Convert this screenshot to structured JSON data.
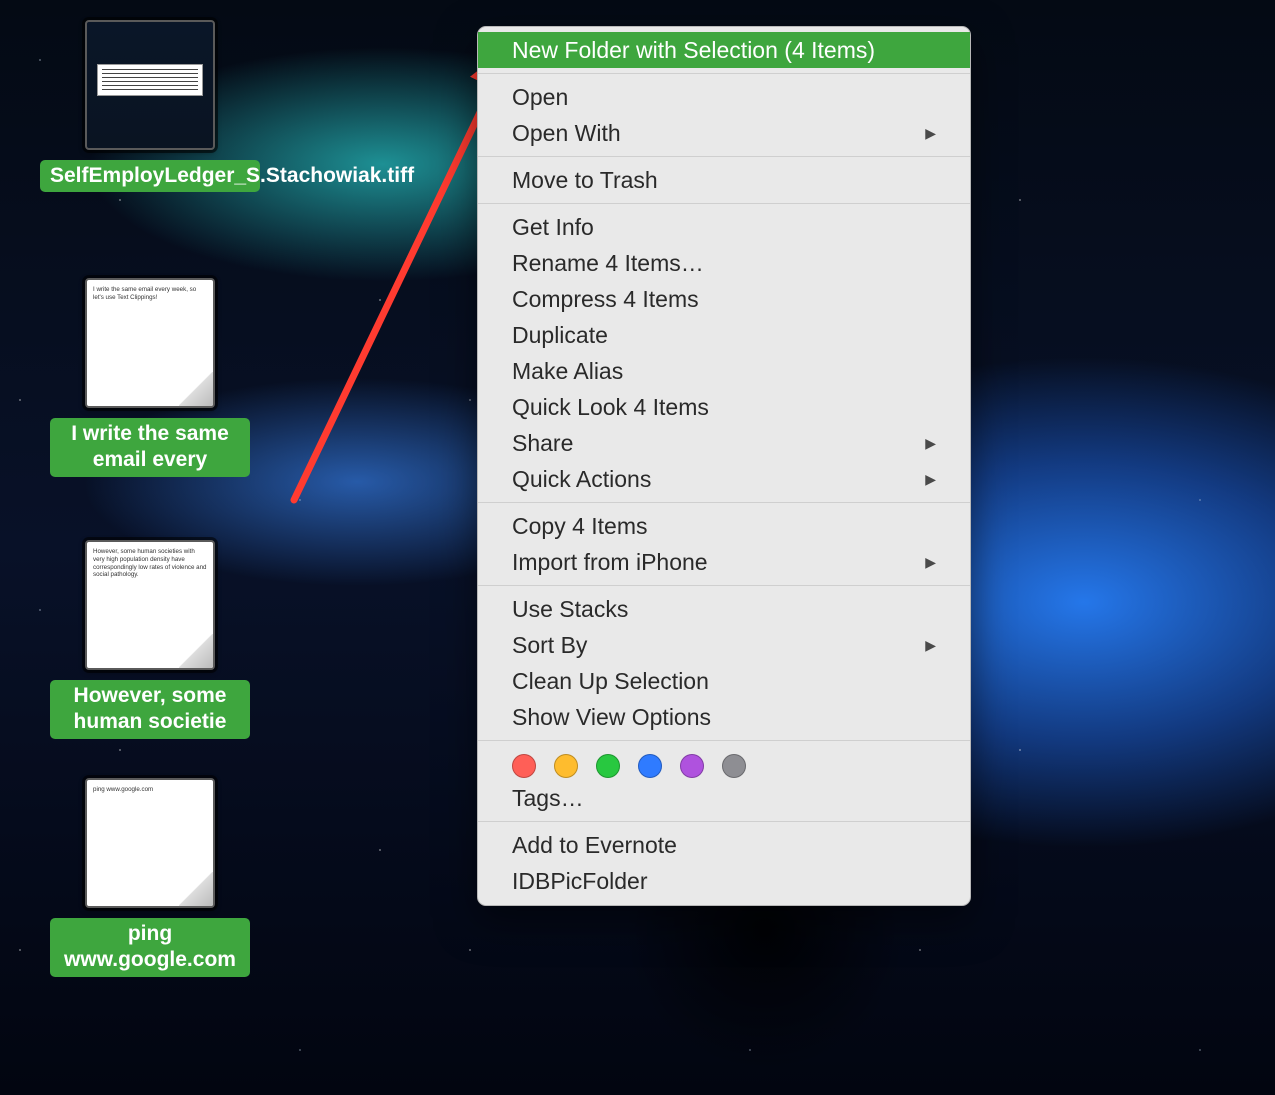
{
  "files": [
    {
      "label": "SelfEmployLedger_S.Stachowiak.tiff",
      "snippet": "",
      "style": "tiff"
    },
    {
      "label": "I write the same email every",
      "snippet": "I write the same email every week, so let's use Text Clippings!",
      "style": "text"
    },
    {
      "label": "However, some human societie",
      "snippet": "However, some human societies with very high population density have correspondingly low rates of violence and social pathology.",
      "style": "text"
    },
    {
      "label": "ping www.google.com",
      "snippet": "ping www.google.com",
      "style": "text"
    }
  ],
  "menu": {
    "highlighted": "New Folder with Selection (4 Items)",
    "groups": [
      [
        {
          "label": "Open"
        },
        {
          "label": "Open With",
          "submenu": true
        }
      ],
      [
        {
          "label": "Move to Trash"
        }
      ],
      [
        {
          "label": "Get Info"
        },
        {
          "label": "Rename 4 Items…"
        },
        {
          "label": "Compress 4 Items"
        },
        {
          "label": "Duplicate"
        },
        {
          "label": "Make Alias"
        },
        {
          "label": "Quick Look 4 Items"
        },
        {
          "label": "Share",
          "submenu": true
        },
        {
          "label": "Quick Actions",
          "submenu": true
        }
      ],
      [
        {
          "label": "Copy 4 Items"
        },
        {
          "label": "Import from iPhone",
          "submenu": true
        }
      ],
      [
        {
          "label": "Use Stacks"
        },
        {
          "label": "Sort By",
          "submenu": true
        },
        {
          "label": "Clean Up Selection"
        },
        {
          "label": "Show View Options"
        }
      ]
    ],
    "tags_label": "Tags…",
    "tag_colors": [
      "#ff5f57",
      "#febc2e",
      "#28c840",
      "#2f7bff",
      "#af52de",
      "#8e8e93"
    ],
    "extras": [
      "Add to Evernote",
      "IDBPicFolder"
    ]
  },
  "arrow_color": "#ff3b30"
}
